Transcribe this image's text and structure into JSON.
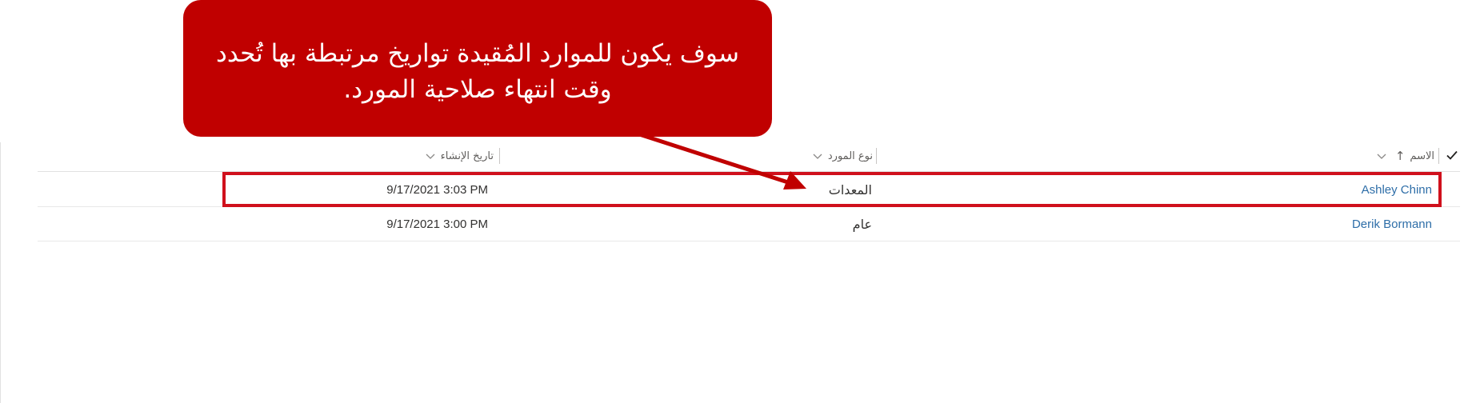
{
  "callout": {
    "text": "سوف يكون للموارد المُقيدة تواريخ مرتبطة بها تُحدد وقت انتهاء صلاحية المورد."
  },
  "grid": {
    "columns": {
      "name": "الاسم",
      "resource_type": "نوع المورد",
      "created_on": "تاريخ الإنشاء"
    },
    "sort_indicator": "↑",
    "rows": [
      {
        "name": "Ashley Chinn",
        "resource_type": "المعدات",
        "created_on": "9/17/2021 3:03 PM"
      },
      {
        "name": "Derik Bormann",
        "resource_type": "عام",
        "created_on": "9/17/2021 3:00 PM"
      }
    ]
  },
  "colors": {
    "callout_bg": "#c00000",
    "highlight_border": "#d0101c",
    "link": "#2e6ea8"
  },
  "icons": {
    "select_all": "checkmark-icon",
    "sort": "arrow-up-icon",
    "column_menu": "chevron-down-icon",
    "annotation": "annotation-arrow"
  }
}
